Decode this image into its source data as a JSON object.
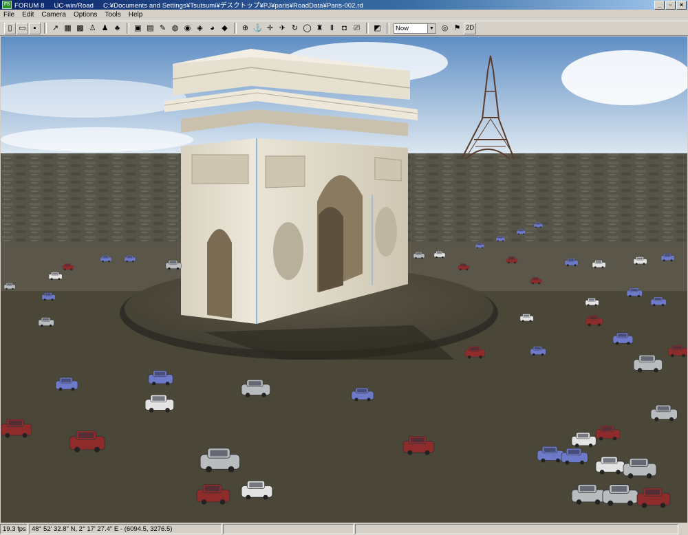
{
  "window": {
    "app": "FORUM 8",
    "product": "UC-win/Road",
    "path": "C:¥Documents and Settings¥Tsutsumi¥デスクトップ¥PJ¥paris¥RoadData¥Paris-002.rd",
    "controls": {
      "minimize": "_",
      "maximize": "▫",
      "close": "×"
    }
  },
  "menu": [
    "File",
    "Edit",
    "Camera",
    "Options",
    "Tools",
    "Help"
  ],
  "toolbar": {
    "groups": [
      [
        {
          "name": "new-icon",
          "glyph": "▯"
        },
        {
          "name": "open-icon",
          "glyph": "▭"
        },
        {
          "name": "save-icon",
          "glyph": "▪"
        }
      ],
      [
        {
          "name": "road-icon",
          "glyph": "↗"
        },
        {
          "name": "intersection-icon",
          "glyph": "▦"
        },
        {
          "name": "terrain-icon",
          "glyph": "▩"
        },
        {
          "name": "person-icon",
          "glyph": "♙"
        },
        {
          "name": "walk-icon",
          "glyph": "♟"
        },
        {
          "name": "tree-icon",
          "glyph": "♣"
        }
      ],
      [
        {
          "name": "model-icon",
          "glyph": "▣"
        },
        {
          "name": "texture-icon",
          "glyph": "▤"
        },
        {
          "name": "edit-icon",
          "glyph": "✎"
        },
        {
          "name": "paint-icon",
          "glyph": "◍"
        },
        {
          "name": "signal-icon",
          "glyph": "◉"
        },
        {
          "name": "path-icon",
          "glyph": "◈"
        },
        {
          "name": "globe-icon",
          "glyph": "◕"
        },
        {
          "name": "vehicle-icon",
          "glyph": "◆"
        }
      ],
      [
        {
          "name": "target-icon",
          "glyph": "⊕"
        },
        {
          "name": "anchor-icon",
          "glyph": "⚓"
        },
        {
          "name": "crosshair-icon",
          "glyph": "✛"
        },
        {
          "name": "plane-icon",
          "glyph": "✈"
        },
        {
          "name": "rotate-icon",
          "glyph": "↻"
        },
        {
          "name": "earth-icon",
          "glyph": "◯"
        },
        {
          "name": "pedestrian-icon",
          "glyph": "♜"
        },
        {
          "name": "pause-icon",
          "glyph": "Ⅱ"
        },
        {
          "name": "car-icon",
          "glyph": "◘"
        },
        {
          "name": "record-icon",
          "glyph": "⎚"
        }
      ],
      [
        {
          "name": "sky-icon",
          "glyph": "◩"
        }
      ]
    ],
    "time_select": "Now",
    "after_select": [
      {
        "name": "sun-icon",
        "glyph": "◎"
      },
      {
        "name": "flag-icon",
        "glyph": "⚑"
      }
    ],
    "mode_button": "2D"
  },
  "scene": {
    "sky_top": "#5f8ec4",
    "sky_bottom": "#dde8f1",
    "ground": "#4a4738",
    "stone": "#e2dccb",
    "car_colors": [
      "#b8bcbe",
      "#6d79c9",
      "#8e2b2b",
      "#e3e3e3"
    ]
  },
  "status": {
    "fps": "19.3 fps",
    "coords": "48°  52' 32.8\" N, 2°  17' 27.4\" E  -  (6094.5, 3276.5)",
    "extra1": "",
    "extra2": ""
  }
}
